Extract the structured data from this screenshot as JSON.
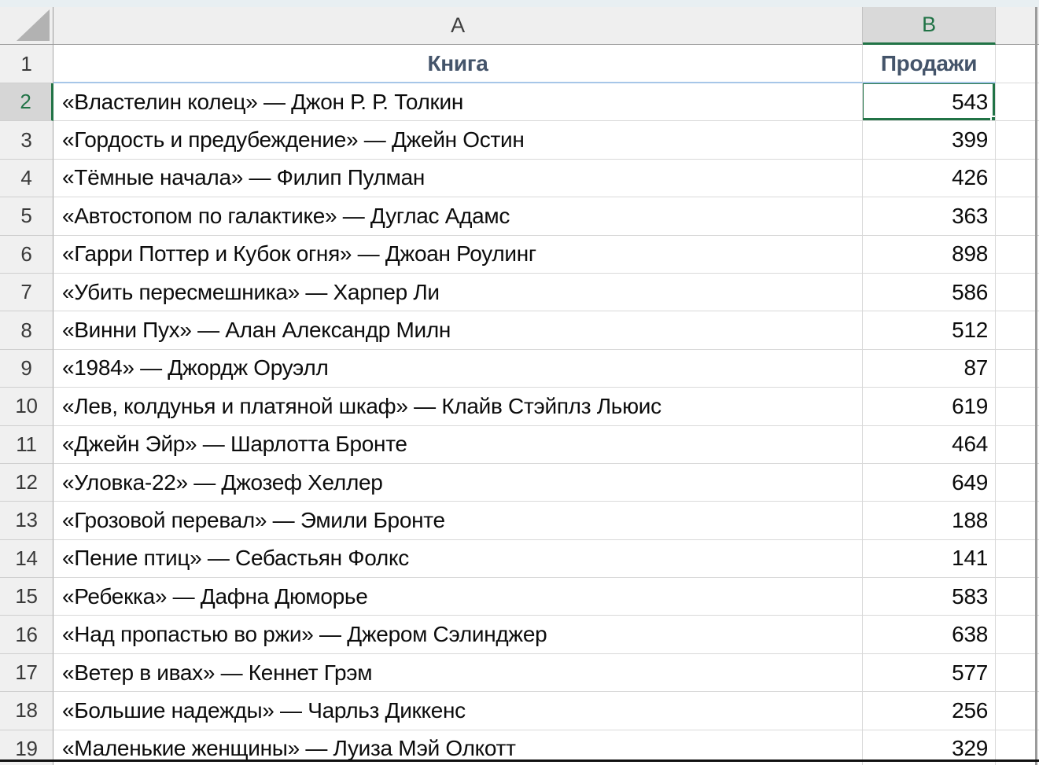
{
  "sheet": {
    "columns": [
      "A",
      "B"
    ],
    "header_row": {
      "number": "1",
      "book_label": "Книга",
      "sales_label": "Продажи"
    },
    "rows": [
      {
        "n": "2",
        "book": "«Властелин колец» — Джон Р. Р. Толкин",
        "sales": "543",
        "selected": true
      },
      {
        "n": "3",
        "book": "«Гордость и предубеждение» — Джейн Остин",
        "sales": "399"
      },
      {
        "n": "4",
        "book": "«Тёмные начала» — Филип Пулман",
        "sales": "426"
      },
      {
        "n": "5",
        "book": "«Автостопом по галактике» — Дуглас Адамс",
        "sales": "363"
      },
      {
        "n": "6",
        "book": "«Гарри Поттер и Кубок огня» — Джоан Роулинг",
        "sales": "898"
      },
      {
        "n": "7",
        "book": "«Убить пересмешника» — Харпер Ли",
        "sales": "586"
      },
      {
        "n": "8",
        "book": "«Винни Пух» — Алан Александр Милн",
        "sales": "512"
      },
      {
        "n": "9",
        "book": "«1984» — Джордж Оруэлл",
        "sales": "87"
      },
      {
        "n": "10",
        "book": "«Лев, колдунья и платяной шкаф» — Клайв Стэйплз Льюис",
        "sales": "619"
      },
      {
        "n": "11",
        "book": "«Джейн Эйр» — Шарлотта Бронте",
        "sales": "464"
      },
      {
        "n": "12",
        "book": "«Уловка-22» — Джозеф Хеллер",
        "sales": "649"
      },
      {
        "n": "13",
        "book": "«Грозовой перевал» — Эмили Бронте",
        "sales": "188"
      },
      {
        "n": "14",
        "book": "«Пение птиц» — Себастьян Фолкс",
        "sales": "141"
      },
      {
        "n": "15",
        "book": "«Ребекка» — Дафна Дюморье",
        "sales": "583"
      },
      {
        "n": "16",
        "book": "«Над пропастью во ржи» — Джером Сэлинджер",
        "sales": "638"
      },
      {
        "n": "17",
        "book": "«Ветер в ивах» — Кеннет Грэм",
        "sales": "577"
      },
      {
        "n": "18",
        "book": "«Большие надежды» — Чарльз Диккенс",
        "sales": "256"
      },
      {
        "n": "19",
        "book": "«Маленькие женщины» — Луиза Мэй Олкотт",
        "sales": "329"
      }
    ],
    "selection": {
      "active_cell": "B2",
      "active_value": "543",
      "selected_column": "B",
      "selected_row": "2"
    },
    "colors": {
      "excel_green": "#217346",
      "header_text": "#44546A",
      "header_underline": "#A6C6E8",
      "selected_header_bg": "#D9D9D9",
      "gridline": "#D9D9D9"
    }
  }
}
